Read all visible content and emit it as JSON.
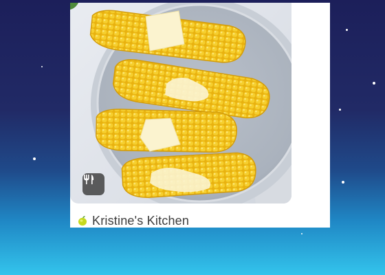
{
  "card": {
    "source_name": "Kristine's Kitchen",
    "photo_icon": "utensils-icon",
    "source_icon": "lime-icon"
  },
  "colors": {
    "sky_top": "#1c1f5a",
    "sky_bottom": "#33c4ec",
    "corn": "#f1c21b",
    "butter": "#fbf3cf"
  }
}
